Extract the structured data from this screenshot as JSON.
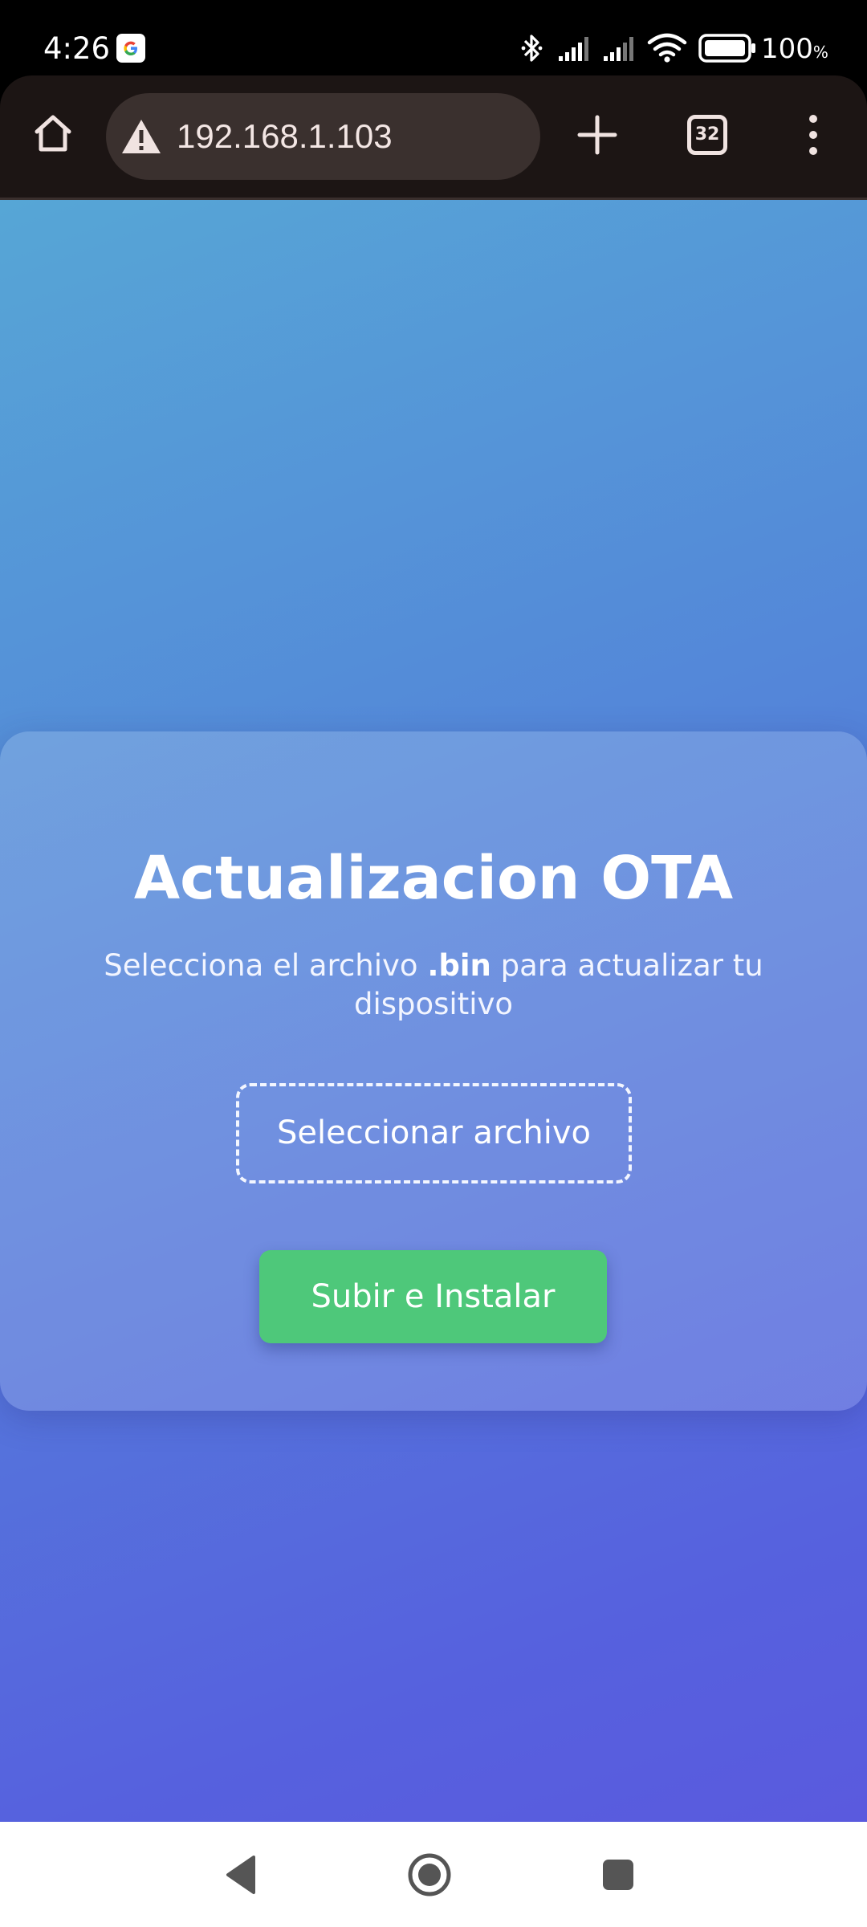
{
  "status_bar": {
    "time": "4:26",
    "battery_value": "100",
    "battery_unit": "%",
    "icons": [
      "google-icon",
      "bluetooth-icon",
      "signal-icon",
      "signal-icon",
      "wifi-icon",
      "battery-icon"
    ]
  },
  "browser": {
    "url": "192.168.1.103",
    "tab_count": "32",
    "icons": [
      "home-icon",
      "warning-icon",
      "plus-icon",
      "tab-switcher-icon",
      "overflow-menu-icon"
    ]
  },
  "page": {
    "title": "Actualizacion OTA",
    "subtitle_before": "Selecciona el archivo ",
    "subtitle_bold": ".bin",
    "subtitle_after": " para actualizar tu dispositivo",
    "file_button_label": "Seleccionar archivo",
    "upload_button_label": "Subir e Instalar"
  },
  "nav_bar": {
    "icons": [
      "back-icon",
      "home-circle-icon",
      "recents-icon"
    ]
  },
  "colors": {
    "upload_button": "#4ec87a",
    "background_gradient_start": "#56a6d6",
    "background_gradient_end": "#5661de",
    "toolbar": "#1c1514"
  }
}
